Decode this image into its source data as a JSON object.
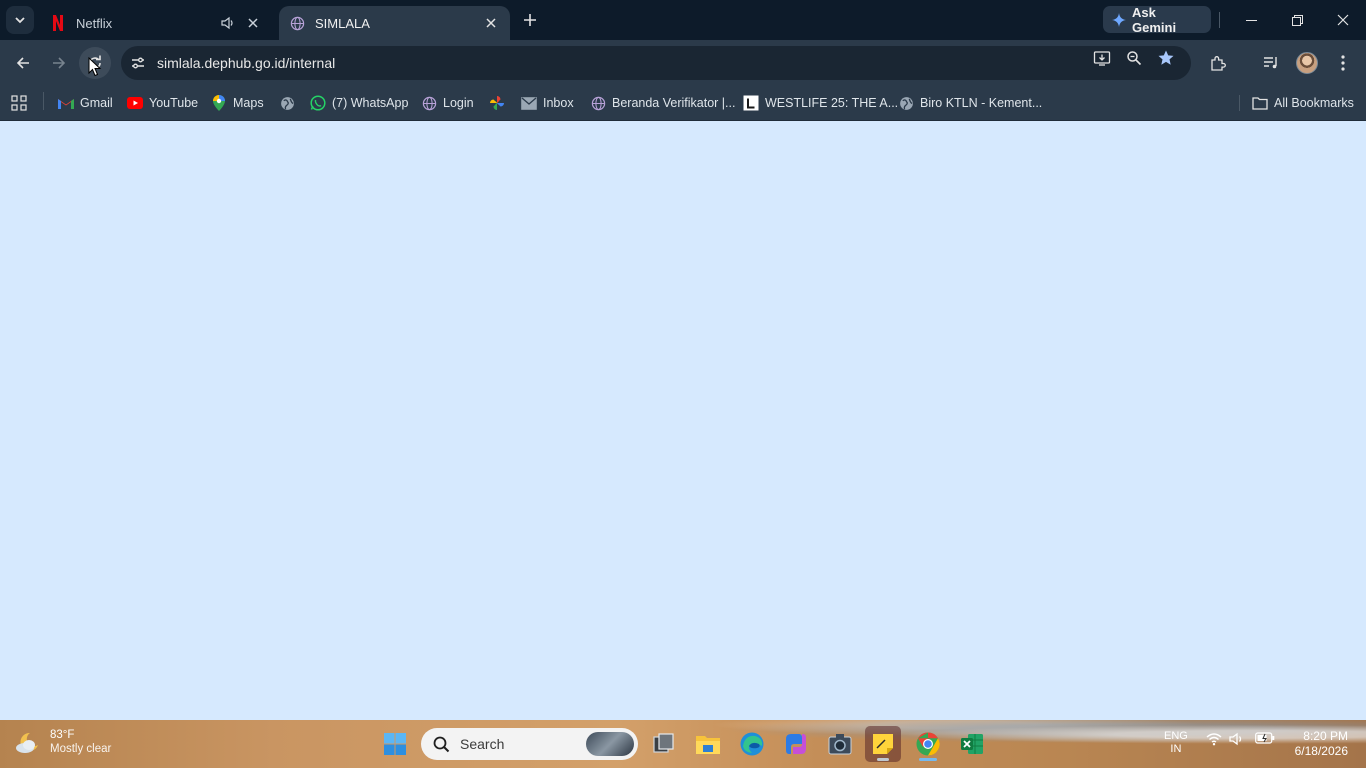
{
  "browser": {
    "tabs": [
      {
        "title": "Netflix",
        "favicon": "netflix-icon",
        "audio": true,
        "active": false
      },
      {
        "title": "SIMLALA",
        "favicon": "globe-icon",
        "audio": false,
        "active": true
      }
    ],
    "ask_gemini_label": "Ask Gemini",
    "url": "simlala.dephub.go.id/internal",
    "bookmarks": [
      {
        "label": "Gmail",
        "icon": "gmail-icon"
      },
      {
        "label": "YouTube",
        "icon": "youtube-icon"
      },
      {
        "label": "Maps",
        "icon": "maps-icon"
      },
      {
        "label": "",
        "icon": "globe-icon"
      },
      {
        "label": "(7) WhatsApp",
        "icon": "whatsapp-icon"
      },
      {
        "label": "Login",
        "icon": "globe-icon"
      },
      {
        "label": "",
        "icon": "pinwheel-icon"
      },
      {
        "label": "Inbox",
        "icon": "mail-icon"
      },
      {
        "label": "Beranda Verifikator |...",
        "icon": "globe-icon"
      },
      {
        "label": "WESTLIFE 25: THE A...",
        "icon": "l-logo-icon"
      },
      {
        "label": "Biro KTLN - Kement...",
        "icon": "globe-icon"
      }
    ],
    "all_bookmarks_label": "All Bookmarks"
  },
  "page": {
    "background": "#d6e9fe"
  },
  "taskbar": {
    "weather": {
      "temp": "83°F",
      "condition": "Mostly clear"
    },
    "search_placeholder": "Search",
    "language": {
      "line1": "ENG",
      "line2": "IN"
    },
    "clock": {
      "time": "8:20 PM",
      "date": "6/18/2026"
    }
  },
  "colors": {
    "accent": "#76b9ed",
    "tab_active_bg": "#2b3a4a",
    "tabstrip_bg": "#0d1b2a"
  }
}
